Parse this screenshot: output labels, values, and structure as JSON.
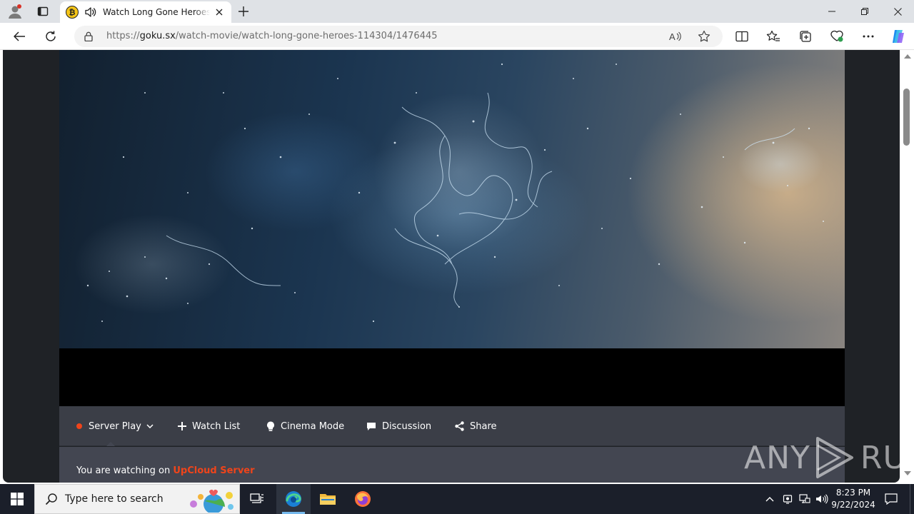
{
  "browser": {
    "tab": {
      "title": "Watch Long Gone Heroes Online",
      "favicon_letter": "₿"
    },
    "address": {
      "url_prefix": "https://",
      "url_host": "goku.sx",
      "url_path": "/watch-movie/watch-long-gone-heroes-114304/1476445"
    }
  },
  "player": {
    "controls": {
      "server": "Server Play",
      "watchlist": "Watch List",
      "cinema": "Cinema Mode",
      "discussion": "Discussion",
      "share": "Share"
    },
    "info": {
      "prefix": "You are watching on",
      "server_name": "UpCloud Server"
    }
  },
  "watermark": {
    "left": "ANY",
    "right": "RUN"
  },
  "taskbar": {
    "search_placeholder": "Type here to search",
    "time": "8:23 PM",
    "date": "9/22/2024"
  },
  "colors": {
    "accent": "#f0441a",
    "controls_bg": "#3b3e47",
    "info_bg": "#434651",
    "taskbar_bg": "#1b1f2a"
  }
}
